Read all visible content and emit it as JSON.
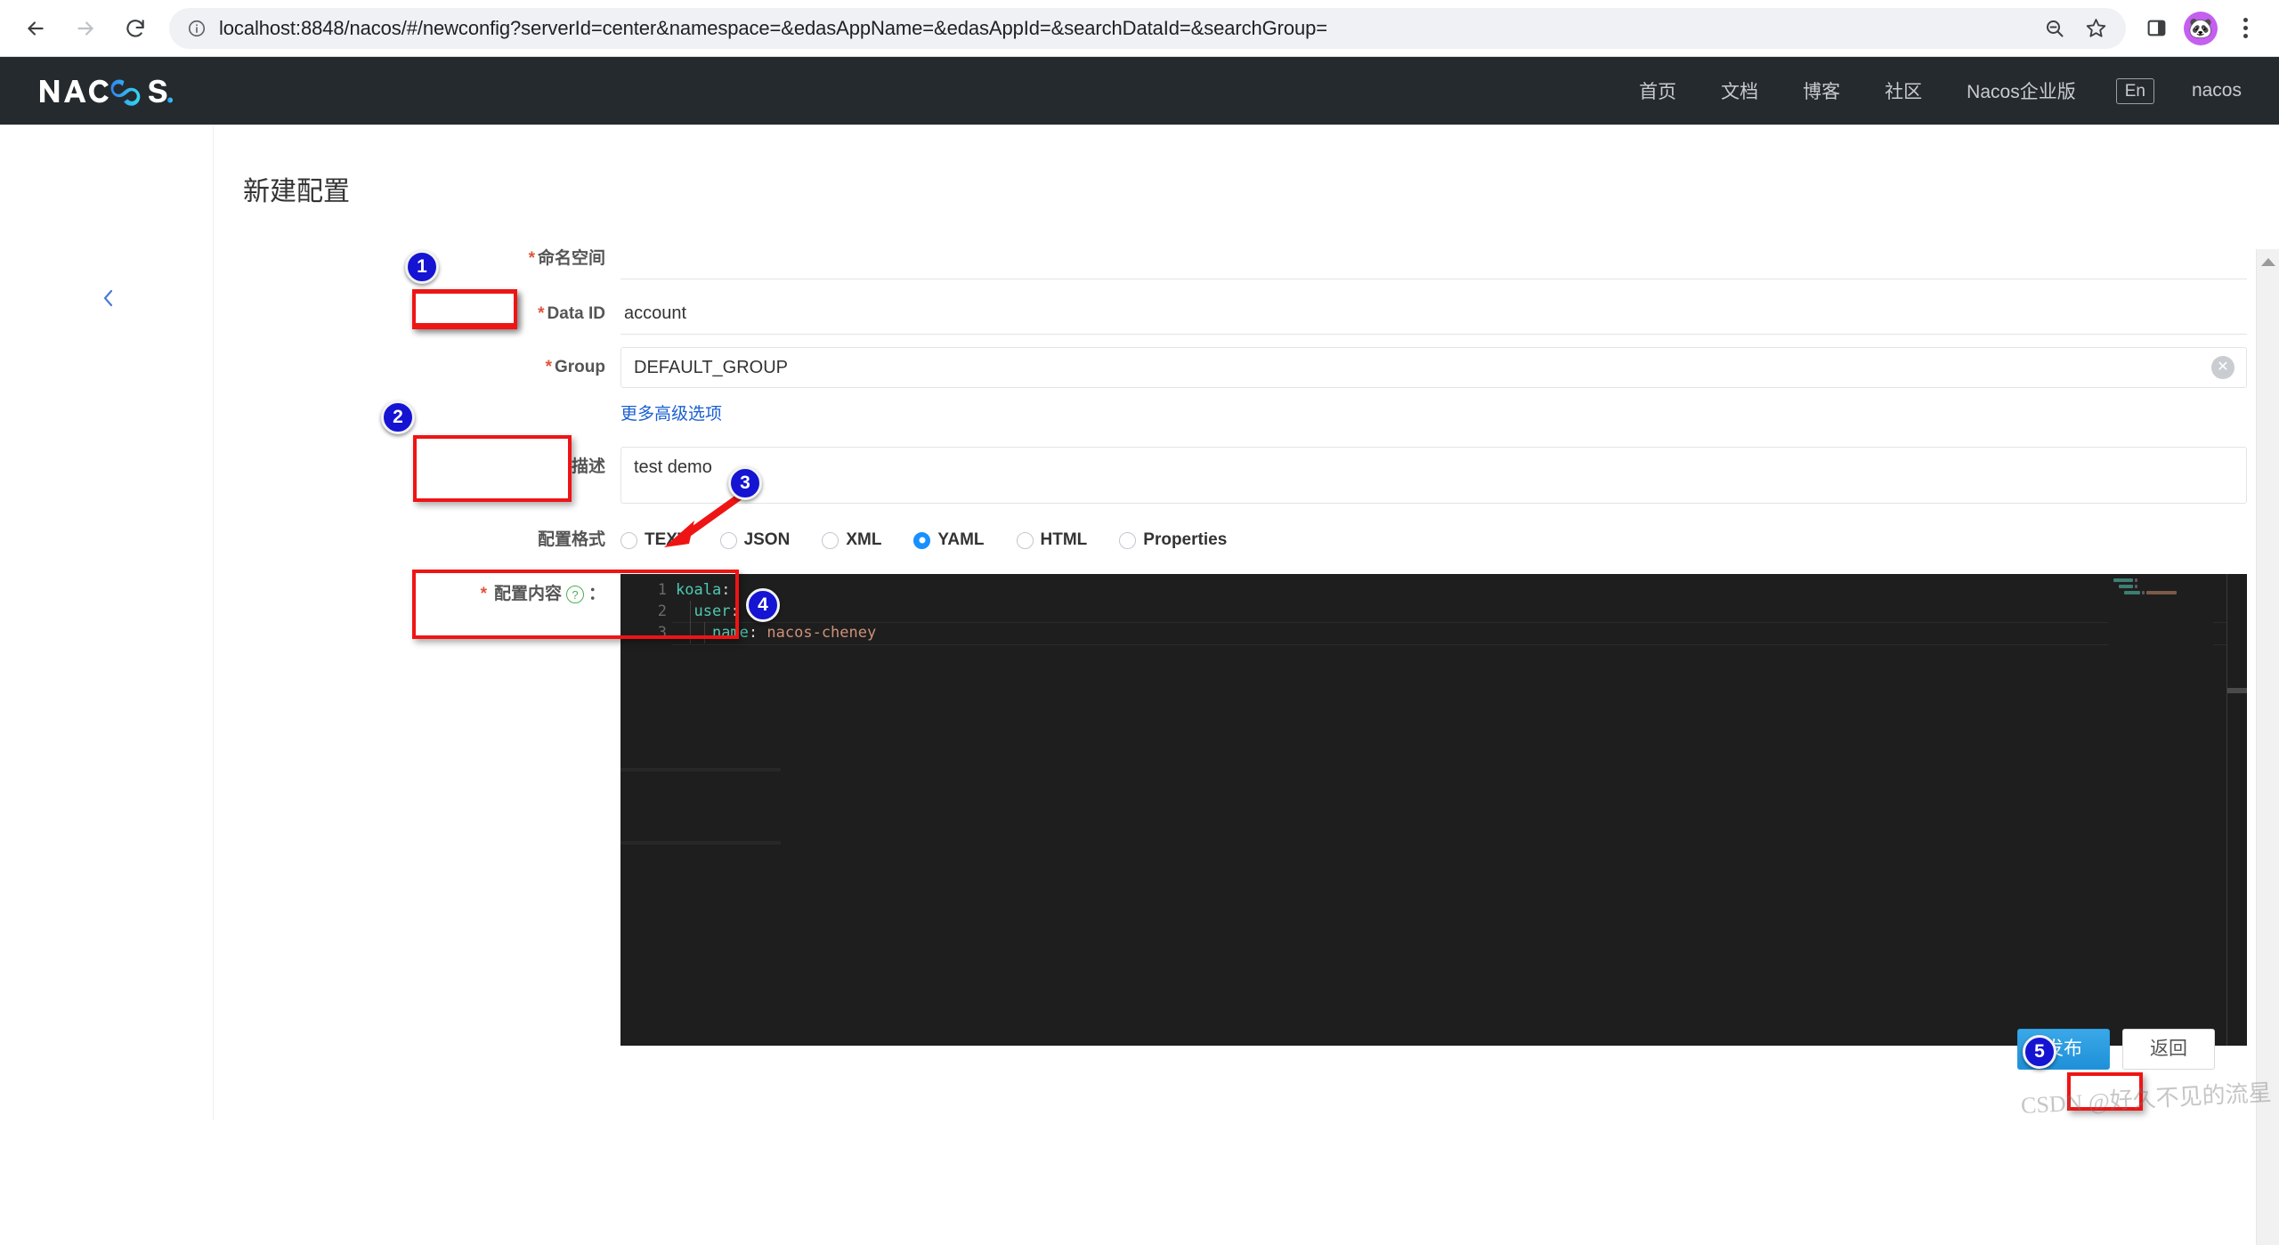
{
  "browser": {
    "url": "localhost:8848/nacos/#/newconfig?serverId=center&namespace=&edasAppName=&edasAppId=&searchDataId=&searchGroup=",
    "back_icon": "back-arrow-icon",
    "forward_icon": "forward-arrow-icon",
    "reload_icon": "reload-icon",
    "info_icon": "site-info-icon",
    "zoom_icon": "zoom-out-icon",
    "bookmark_icon": "star-bookmark-icon",
    "sidepanel_icon": "side-panel-icon",
    "avatar_icon": "panda-avatar-icon",
    "menu_icon": "three-dot-menu-icon"
  },
  "header": {
    "logo_text": "NACOS.",
    "nav": [
      {
        "label": "首页"
      },
      {
        "label": "文档"
      },
      {
        "label": "博客"
      },
      {
        "label": "社区"
      },
      {
        "label": "Nacos企业版"
      }
    ],
    "lang": "En",
    "user": "nacos"
  },
  "sidebar": {
    "collapse_icon": "chevron-left-icon"
  },
  "main": {
    "title": "新建配置",
    "fields": {
      "namespace": {
        "label": "命名空间",
        "required": true,
        "value": ""
      },
      "data_id": {
        "label": "Data ID",
        "required": true,
        "value": "account"
      },
      "group": {
        "label": "Group",
        "required": true,
        "value": "DEFAULT_GROUP",
        "clear_icon": "clear-circle-icon"
      },
      "advanced_link": "更多高级选项",
      "description": {
        "label": "描述",
        "required": false,
        "value": "test demo"
      },
      "format": {
        "label": "配置格式",
        "options": [
          "TEXT",
          "JSON",
          "XML",
          "YAML",
          "HTML",
          "Properties"
        ],
        "selected": "YAML"
      },
      "content": {
        "label": "配置内容",
        "required": true,
        "help_icon": "question-mark-icon",
        "suffix": "："
      }
    },
    "editor": {
      "line_numbers": [
        "1",
        "2",
        "3"
      ],
      "lines": [
        {
          "key": "koala",
          "colon": ":",
          "value": "",
          "indent": 0
        },
        {
          "key": "user",
          "colon": ":",
          "value": "",
          "indent": 1
        },
        {
          "key": "name",
          "colon": ":",
          "value": "nacos-cheney",
          "indent": 2
        }
      ]
    },
    "footer": {
      "publish_label": "发布",
      "back_label": "返回"
    }
  },
  "annotations": {
    "badges": [
      "1",
      "2",
      "3",
      "4",
      "5"
    ],
    "highlight_color": "#ef1414",
    "badge_color": "#1414d2"
  },
  "watermark": "CSDN @好久不见的流星"
}
